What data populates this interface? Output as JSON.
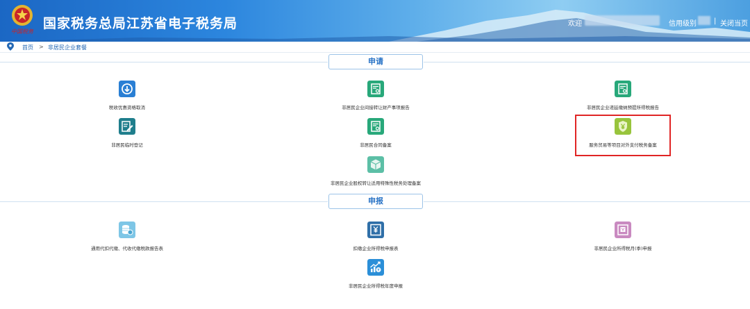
{
  "header": {
    "title": "国家税务总局江苏省电子税务局",
    "emblem_text": "中国税务",
    "welcome": "欢迎",
    "credit_link": "信用级别",
    "separator": "|",
    "close_link": "关闭当页"
  },
  "breadcrumb": {
    "home": "首页",
    "arrow": ">",
    "current": "非居民企业套餐"
  },
  "sections": {
    "apply": "申请",
    "declare": "申报"
  },
  "apply_items": [
    {
      "label": "税收优惠资格取消",
      "icon": "download-circle-icon",
      "color": "#2a7fd4"
    },
    {
      "label": "非居民企业间接转让财产事项报告",
      "icon": "certificate-icon",
      "color": "#28a87a"
    },
    {
      "label": "非居民企业递延缴纳预提所得税报告",
      "icon": "certificate-icon",
      "color": "#28a87a"
    },
    {
      "label": "非居民临时登记",
      "icon": "edit-form-icon",
      "color": "#1f7e8c"
    },
    {
      "label": "非居民合同备案",
      "icon": "certificate-icon",
      "color": "#28a87a"
    },
    {
      "label": "服务贸易等项目对外支付税务备案",
      "icon": "yen-shield-icon",
      "color": "#98c43c"
    },
    {
      "label": "非居民企业股权转让适用特殊性税务处理备案",
      "icon": "package-icon",
      "color": "#5cbfa6"
    }
  ],
  "declare_items": [
    {
      "label": "通用代扣代缴、代收代缴税款报告表",
      "icon": "coin-stack-icon",
      "color": "#7ec6e6"
    },
    {
      "label": "扣缴企业所得税申报表",
      "icon": "yen-report-icon",
      "color": "#2f6fa8"
    },
    {
      "label": "非居民企业所得税月(季)申报",
      "icon": "receipt-icon",
      "color": "#c98ac0"
    },
    {
      "label": "非居民企业所得税年度申报",
      "icon": "growth-chart-icon",
      "color": "#2b8fd8"
    }
  ]
}
